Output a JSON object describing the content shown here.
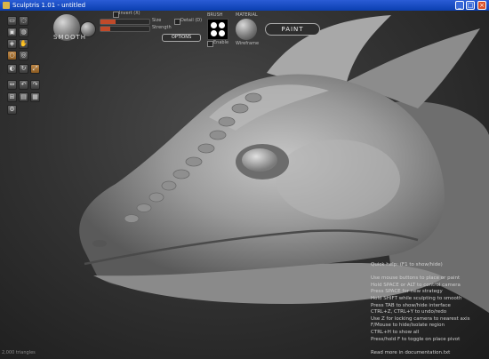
{
  "window": {
    "title": "Sculptris 1.01 - untitled",
    "min_label": "_",
    "max_label": "□",
    "close_label": "×"
  },
  "brush_panel": {
    "mode_label": "SMOOTH",
    "invert_label": "Invert (X)",
    "size_label": "Size",
    "strength_label": "Strength",
    "detail_label": "Detail (D)",
    "options_label": "OPTIONS",
    "size_value": 0.3,
    "strength_value": 0.2
  },
  "brush_picker": {
    "label": "BRUSH",
    "enable_label": "Enable"
  },
  "material": {
    "label": "MATERIAL",
    "sub_label": "Wireframe"
  },
  "paint_button": {
    "label": "PAINT"
  },
  "tools": [
    {
      "icon": "draw-icon",
      "glyph": "▭"
    },
    {
      "icon": "crease-icon",
      "glyph": "◌"
    },
    {
      "icon": "flatten-icon",
      "glyph": "▣"
    },
    {
      "icon": "inflate-icon",
      "glyph": "◍"
    },
    {
      "icon": "pinch-icon",
      "glyph": "◈"
    },
    {
      "icon": "grab-icon",
      "glyph": "✋"
    },
    {
      "icon": "smooth-icon",
      "glyph": "○"
    },
    {
      "icon": "reduce-icon",
      "glyph": "◎"
    },
    {
      "icon": "mask-icon",
      "glyph": "◐"
    },
    {
      "icon": "rotate-icon",
      "glyph": "↻"
    },
    {
      "icon": "scale-icon",
      "glyph": "⤢"
    },
    {
      "icon": "symmetry-icon",
      "glyph": "⇔"
    },
    {
      "icon": "undo-icon",
      "glyph": "↶"
    },
    {
      "icon": "redo-icon",
      "glyph": "↷"
    },
    {
      "icon": "subdivide-icon",
      "glyph": "⊞"
    },
    {
      "icon": "file-icon",
      "glyph": "▤"
    },
    {
      "icon": "save-icon",
      "glyph": "▦"
    },
    {
      "icon": "settings-icon",
      "glyph": "⚙"
    }
  ],
  "help_lines": [
    "Quick help: (F1 to show/hide)",
    "",
    "Use mouse buttons to place or paint",
    "Hold SPACE or ALT to control camera",
    "Press SPACE for new strategy",
    "Hold SHIFT while sculpting to smooth",
    "Press TAB to show/hide interface",
    "CTRL+Z, CTRL+Y to undo/redo",
    "Use Z for locking camera to nearest axis",
    "F/Mouse to hide/isolate region",
    "CTRL+H to show all",
    "Press/hold F to toggle on place pivot",
    "",
    "Read more in documentation.txt"
  ],
  "stats": {
    "text": "2,000 triangles"
  }
}
